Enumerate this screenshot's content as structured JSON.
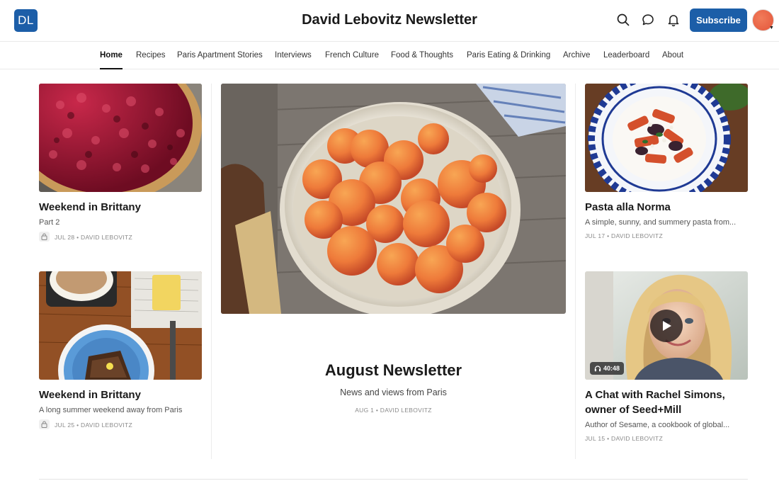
{
  "header": {
    "logo_text": "DL",
    "site_title": "David Lebovitz Newsletter",
    "subscribe_label": "Subscribe",
    "icons": [
      "search-icon",
      "chat-icon",
      "bell-icon"
    ],
    "brand_color": "#1c5ea8"
  },
  "nav": {
    "items": [
      {
        "label": "Home",
        "active": true
      },
      {
        "label": "Recipes"
      },
      {
        "label": "Paris Apartment Stories"
      },
      {
        "label": "Interviews"
      },
      {
        "label": "French Culture"
      },
      {
        "label": "Food & Thoughts"
      },
      {
        "label": "Paris Eating & Drinking"
      },
      {
        "label": "Archive"
      },
      {
        "label": "Leaderboard"
      },
      {
        "label": "About"
      }
    ]
  },
  "posts": {
    "left_top": {
      "title": "Weekend in Brittany",
      "subtitle": "Part 2",
      "meta": "JUL 28 • DAVID LEBOVITZ",
      "locked": true,
      "image": "cherry tart"
    },
    "left_bottom": {
      "title": "Weekend in Brittany",
      "subtitle": "A long summer weekend away from Paris",
      "meta": "JUL 25 • DAVID LEBOVITZ",
      "locked": true,
      "image": "coffee and cake"
    },
    "featured": {
      "title": "August Newsletter",
      "subtitle": "News and views from Paris",
      "meta": "AUG 1 • DAVID LEBOVITZ",
      "image": "bowl of apricots"
    },
    "right_top": {
      "title": "Pasta alla Norma",
      "subtitle": "A simple, sunny, and summery pasta from...",
      "meta": "JUL 17 • DAVID LEBOVITZ",
      "image": "pasta on blue plate"
    },
    "right_bottom": {
      "title_line1": "A Chat with Rachel Simons,",
      "title_line2": "owner of Seed+Mill",
      "subtitle": "Author of Sesame, a cookbook of global...",
      "meta": "JUL 15 • DAVID LEBOVITZ",
      "duration": "40:48",
      "image": "portrait of woman"
    }
  }
}
